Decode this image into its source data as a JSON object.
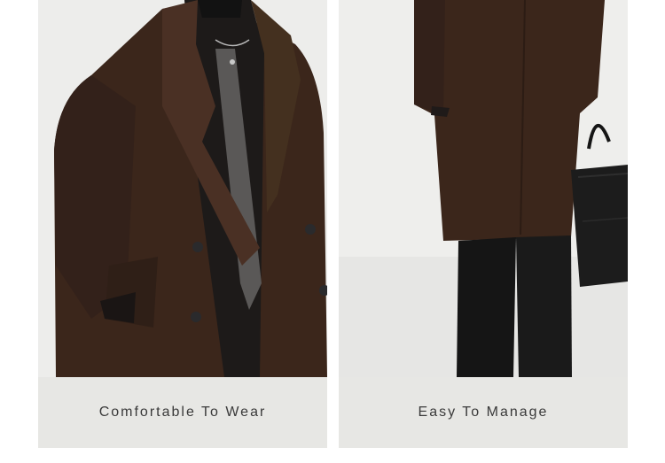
{
  "panels": [
    {
      "caption": "Comfortable To Wear",
      "image": "brown-double-breasted-coat-closeup"
    },
    {
      "caption": "Easy To Manage",
      "image": "brown-coat-with-black-trousers-and-handbag"
    }
  ],
  "colors": {
    "coat": "#3b261b",
    "background": "#ededeb",
    "caption_bg": "#e7e7e4",
    "caption_text": "#3a3a3a"
  }
}
